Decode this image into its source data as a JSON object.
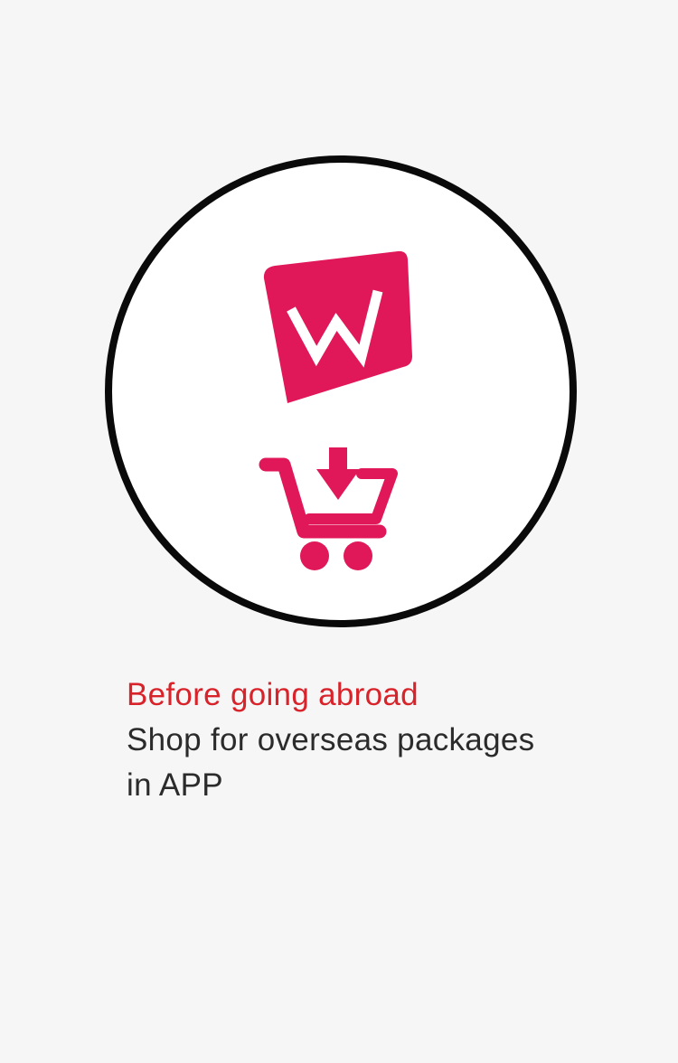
{
  "illustration": {
    "logo_icon": "w-app-logo-icon",
    "cart_icon": "cart-download-icon",
    "accent_color": "#e0185a",
    "circle_border_color": "#0a0a0a"
  },
  "caption": {
    "headline": "Before going abroad",
    "line1": "Shop for overseas packages",
    "line2": "in APP",
    "headline_color": "#d8232a"
  }
}
